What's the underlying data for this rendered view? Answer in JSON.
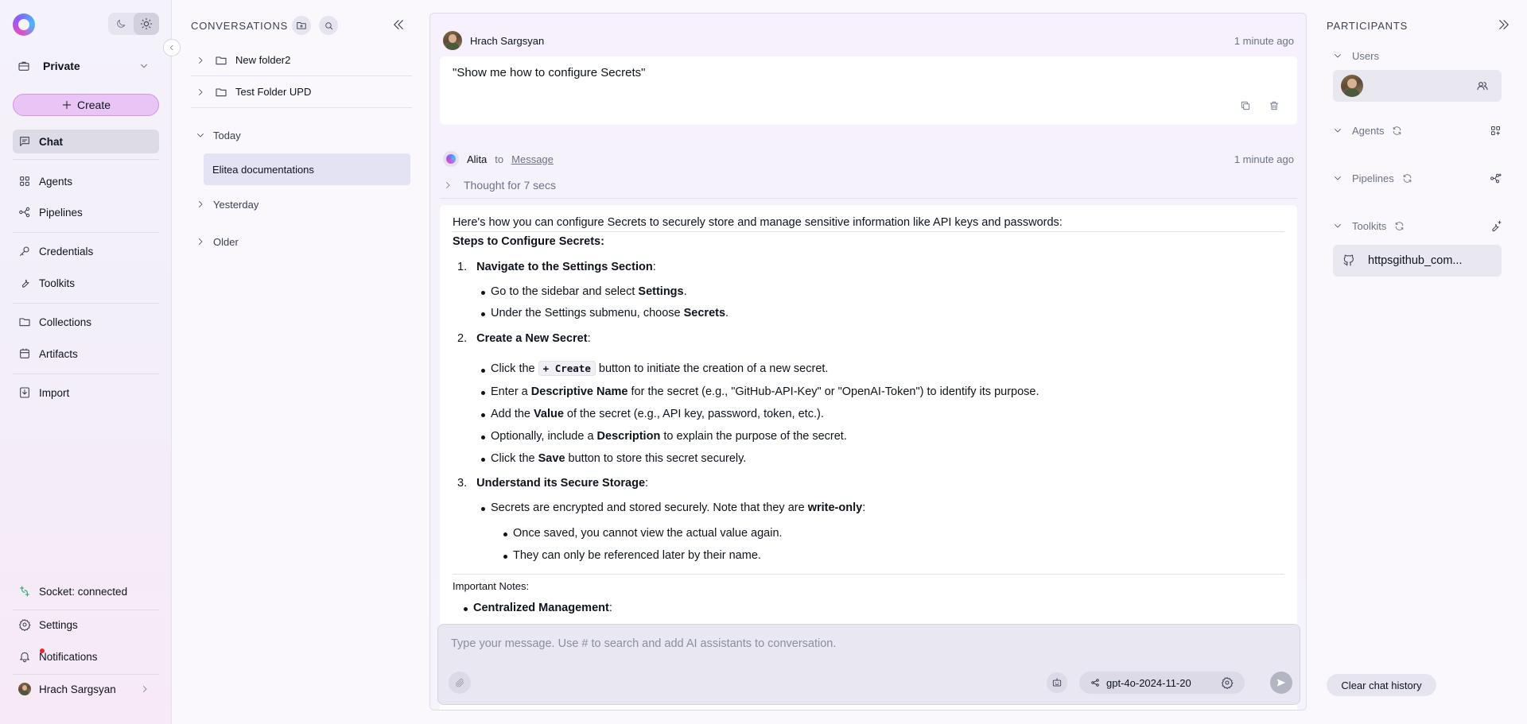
{
  "nav": {
    "project": "Private",
    "create_label": "Create",
    "items": [
      {
        "label": "Chat"
      },
      {
        "label": "Agents"
      },
      {
        "label": "Pipelines"
      },
      {
        "label": "Credentials"
      },
      {
        "label": "Toolkits"
      },
      {
        "label": "Collections"
      },
      {
        "label": "Artifacts"
      },
      {
        "label": "Import"
      }
    ],
    "socket_status": "Socket: connected",
    "settings_label": "Settings",
    "notifications_label": "Notifications",
    "user_name": "Hrach Sargsyan"
  },
  "conversations": {
    "title": "CONVERSATIONS",
    "folders": [
      {
        "label": "New folder2"
      },
      {
        "label": "Test Folder UPD"
      }
    ],
    "groups": {
      "today": "Today",
      "yesterday": "Yesterday",
      "older": "Older"
    },
    "active_item": "Elitea documentations"
  },
  "chat": {
    "user_message": {
      "author": "Hrach Sargsyan",
      "time": "1 minute ago",
      "text": "\"Show me how to configure Secrets\""
    },
    "assistant_message": {
      "author": "Alita",
      "to_label": "to",
      "target_link": "Message",
      "time": "1 minute ago",
      "thought": "Thought for 7 secs",
      "intro": "Here's how you can configure Secrets to securely store and manage sensitive information like API keys and passwords:",
      "heading": "Steps to Configure Secrets:",
      "steps": [
        {
          "num": "1.",
          "title": "Navigate to the Settings Section"
        },
        {
          "num": "2.",
          "title": "Create a New Secret"
        },
        {
          "num": "3.",
          "title": "Understand its Secure Storage"
        }
      ],
      "step1_b1_pre": "Go to the sidebar and select ",
      "step1_b1_bold": "Settings",
      "step1_b2_pre": "Under the Settings submenu, choose ",
      "step1_b2_bold": "Secrets",
      "step2_b1_pre": "Click the ",
      "step2_b1_code": "+ Create",
      "step2_b1_post": " button to initiate the creation of a new secret.",
      "step2_b2_pre": "Enter a ",
      "step2_b2_bold": "Descriptive Name",
      "step2_b2_post": " for the secret (e.g., \"GitHub-API-Key\" or \"OpenAI-Token\") to identify its purpose.",
      "step2_b3_pre": "Add the ",
      "step2_b3_bold": "Value",
      "step2_b3_post": " of the secret (e.g., API key, password, token, etc.).",
      "step2_b4_pre": "Optionally, include a ",
      "step2_b4_bold": "Description",
      "step2_b4_post": " to explain the purpose of the secret.",
      "step2_b5_pre": "Click the ",
      "step2_b5_bold": "Save",
      "step2_b5_post": " button to store this secret securely.",
      "step3_b1_pre": "Secrets are encrypted and stored securely. Note that they are ",
      "step3_b1_bold": "write-only",
      "step3_sub1": "Once saved, you cannot view the actual value again.",
      "step3_sub2": "They can only be referenced later by their name.",
      "notes_heading": "Important Notes:",
      "notes_item": "Centralized Management"
    },
    "composer": {
      "placeholder": "Type your message. Use # to search and add AI assistants to conversation.",
      "model": "gpt-4o-2024-11-20"
    }
  },
  "participants": {
    "title": "PARTICIPANTS",
    "sections": {
      "users": "Users",
      "agents": "Agents",
      "pipelines": "Pipelines",
      "toolkits": "Toolkits"
    },
    "toolkit_item": "httpsgithub_com...",
    "clear_label": "Clear chat history"
  }
}
